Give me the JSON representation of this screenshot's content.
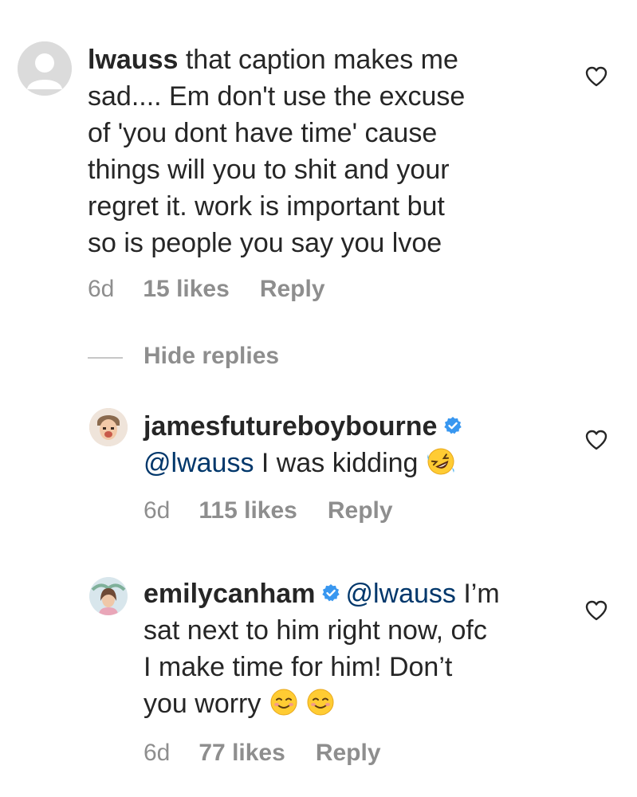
{
  "comments": [
    {
      "username": "lwauss",
      "text_lines": [
        "that caption makes me",
        "sad.... Em don't use the excuse",
        "of 'you dont have time' cause",
        "things will you to shit and your",
        "regret it. work is important but",
        "so is people you say you lvoe"
      ],
      "time": "6d",
      "likes": "15 likes",
      "reply": "Reply"
    }
  ],
  "hide_replies": "Hide replies",
  "replies": [
    {
      "username": "jamesfutureboybourne",
      "mention": "@lwauss",
      "text": " I was kidding ",
      "emoji": "rolling-on-floor-laughing",
      "time": "6d",
      "likes": "115 likes",
      "reply": "Reply"
    },
    {
      "username": "emilycanham",
      "mention": "@lwauss",
      "text_line1": " I’m",
      "text_line2": "sat next to him right now, ofc",
      "text_line3": "I make time for him! Don’t",
      "text_line4": "you worry ",
      "emoji": "smiling-face",
      "time": "6d",
      "likes": "77 likes",
      "reply": "Reply"
    }
  ],
  "colors": {
    "text": "#262626",
    "meta": "#8e8e8e",
    "mention": "#00376b",
    "verified": "#3897f0"
  }
}
